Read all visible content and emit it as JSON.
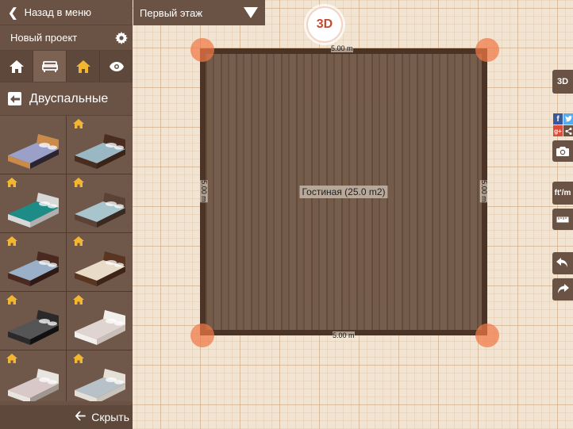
{
  "sidebar": {
    "back_label": "Назад в меню",
    "project_name": "Новый проект",
    "tabs": [
      {
        "icon": "home-icon"
      },
      {
        "icon": "sofa-icon"
      },
      {
        "icon": "home-premium-icon"
      },
      {
        "icon": "eye-icon"
      }
    ],
    "category_label": "Двуспальные",
    "hide_label": "Скрыть",
    "items": [
      {
        "name": "bed-dark-wood",
        "locked": false
      },
      {
        "name": "bed-brown-frame",
        "locked": true
      },
      {
        "name": "bed-teal-white",
        "locked": true
      },
      {
        "name": "bed-grey-headboard",
        "locked": true
      },
      {
        "name": "bed-dark-headboard",
        "locked": true
      },
      {
        "name": "bed-slatted-wood",
        "locked": true
      },
      {
        "name": "bed-black-platform",
        "locked": true
      },
      {
        "name": "bed-white-ornate",
        "locked": true
      },
      {
        "name": "bed-metal-frame",
        "locked": true
      },
      {
        "name": "bed-daybed",
        "locked": true
      }
    ]
  },
  "floor_select": {
    "value": "Первый этаж"
  },
  "view_toggle": {
    "label": "3D"
  },
  "room": {
    "label": "Гостиная (25.0 m2)",
    "dim_top": "5.00 m",
    "dim_bottom": "5.00 m",
    "dim_left": "5.00 m",
    "dim_right": "5.00 m"
  },
  "right_toolbar": {
    "view3d_label": "3D",
    "units_label": "ft'/m",
    "social": {
      "facebook": "f",
      "googleplus": "g+"
    }
  },
  "colors": {
    "sidebar": "#6a5344",
    "accent": "#c44a32",
    "corner_handle": "#f07846",
    "wall": "#4b3426",
    "floor": "#6e5443",
    "lock_icon": "#f2b630"
  }
}
